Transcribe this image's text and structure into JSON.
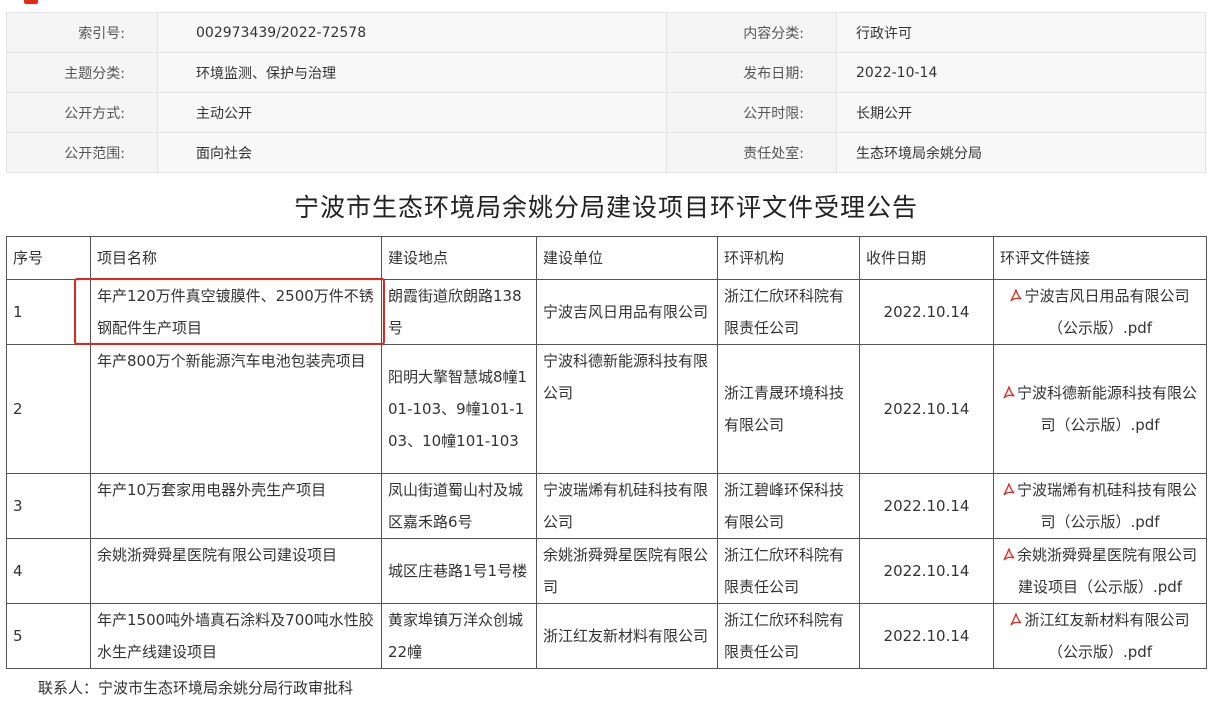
{
  "meta": {
    "index_label": "索引号:",
    "index_value": "002973439/2022-72578",
    "content_label": "内容分类:",
    "content_value": "行政许可",
    "topic_label": "主题分类:",
    "topic_value": "环境监测、保护与治理",
    "date_label": "发布日期:",
    "date_value": "2022-10-14",
    "method_label": "公开方式:",
    "method_value": "主动公开",
    "period_label": "公开时限:",
    "period_value": "长期公开",
    "scope_label": "公开范围:",
    "scope_value": "面向社会",
    "office_label": "责任处室:",
    "office_value": "生态环境局余姚分局"
  },
  "title": "宁波市生态环境局余姚分局建设项目环评文件受理公告",
  "table": {
    "headers": [
      "序号",
      "项目名称",
      "建设地点",
      "建设单位",
      "环评机构",
      "收件日期",
      "环评文件链接"
    ],
    "rows": [
      {
        "no": "1",
        "name": "年产120万件真空镀膜件、2500万件不锈钢配件生产项目",
        "location": "朗霞街道欣朗路138号",
        "unit": "宁波吉风日用品有限公司",
        "agency": "浙江仁欣环科院有限责任公司",
        "date": "2022.10.14",
        "link": "宁波吉风日用品有限公司（公示版）.pdf"
      },
      {
        "no": "2",
        "name": "年产800万个新能源汽车电池包装壳项目",
        "location": "阳明大擎智慧城8幢101-103、9幢101-103、10幢101-103",
        "unit": "宁波科德新能源科技有限公司",
        "agency": "浙江青晟环境科技有限公司",
        "date": "2022.10.14",
        "link": "宁波科德新能源科技有限公司（公示版）.pdf"
      },
      {
        "no": "3",
        "name": "年产10万套家用电器外壳生产项目",
        "location": "凤山街道蜀山村及城区嘉禾路6号",
        "unit": "宁波瑞烯有机硅科技有限公司",
        "agency": "浙江碧峰环保科技有限公司",
        "date": "2022.10.14",
        "link": "宁波瑞烯有机硅科技有限公司（公示版）.pdf"
      },
      {
        "no": "4",
        "name": "余姚浙舜舜星医院有限公司建设项目",
        "location": "城区庄巷路1号1号楼",
        "unit": "余姚浙舜舜星医院有限公司",
        "agency": "浙江仁欣环科院有限责任公司",
        "date": "2022.10.14",
        "link": "余姚浙舜舜星医院有限公司建设项目（公示版）.pdf"
      },
      {
        "no": "5",
        "name": "年产1500吨外墙真石涂料及700吨水性胶水生产线建设项目",
        "location": "黄家埠镇万洋众创城22幢",
        "unit": "浙江红友新材料有限公司",
        "agency": "浙江仁欣环科院有限责任公司",
        "date": "2022.10.14",
        "link": "浙江红友新材料有限公司（公示版）.pdf"
      }
    ]
  },
  "contact": "联系人：宁波市生态环境局余姚分局行政审批科",
  "colors": {
    "highlight": "#e3251c",
    "pdf_icon": "#d93025"
  }
}
